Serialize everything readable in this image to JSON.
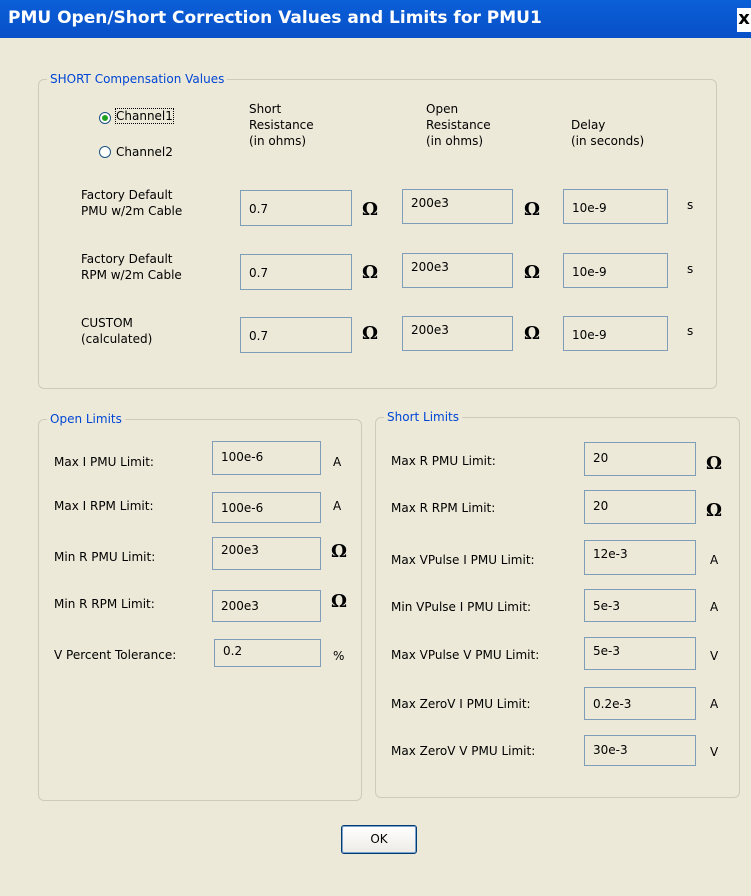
{
  "window": {
    "title": "PMU Open/Short Correction Values and Limits for PMU1",
    "close_label": "x"
  },
  "short_comp": {
    "title": "SHORT Compensation Values",
    "channels": [
      {
        "label": "Channel1",
        "selected": true
      },
      {
        "label": "Channel2",
        "selected": false
      }
    ],
    "headers": {
      "short": [
        "Short",
        "Resistance",
        "(in ohms)"
      ],
      "open": [
        "Open",
        "Resistance",
        "(in ohms)"
      ],
      "delay": [
        "Delay",
        "(in seconds)"
      ]
    },
    "rows": [
      {
        "label": [
          "Factory Default",
          "PMU w/2m Cable"
        ],
        "short": "0.7",
        "open": "200e3",
        "delay": "10e-9"
      },
      {
        "label": [
          "Factory Default",
          "RPM w/2m Cable"
        ],
        "short": "0.7",
        "open": "200e3",
        "delay": "10e-9"
      },
      {
        "label": [
          "CUSTOM",
          "(calculated)"
        ],
        "short": "0.7",
        "open": "200e3",
        "delay": "10e-9"
      }
    ],
    "ohm_symbol": "Ω",
    "sec_unit": "s"
  },
  "open_limits": {
    "title": "Open Limits",
    "rows": [
      {
        "label": "Max I PMU Limit:",
        "value": "100e-6",
        "unit": "A"
      },
      {
        "label": "Max I RPM Limit:",
        "value": "100e-6",
        "unit": "A"
      },
      {
        "label": "Min R PMU Limit:",
        "value": "200e3",
        "unit": "Ω"
      },
      {
        "label": "Min R RPM Limit:",
        "value": "200e3",
        "unit": "Ω"
      },
      {
        "label": "V Percent Tolerance:",
        "value": "0.2",
        "unit": "%"
      }
    ]
  },
  "short_limits": {
    "title": "Short Limits",
    "rows": [
      {
        "label": "Max R PMU Limit:",
        "value": "20",
        "unit": "Ω"
      },
      {
        "label": "Max R RPM Limit:",
        "value": "20",
        "unit": "Ω"
      },
      {
        "label": "Max VPulse I PMU Limit:",
        "value": "12e-3",
        "unit": "A"
      },
      {
        "label": "Min VPulse I PMU Limit:",
        "value": "5e-3",
        "unit": "A"
      },
      {
        "label": "Max VPulse V PMU Limit:",
        "value": "5e-3",
        "unit": "V"
      },
      {
        "label": "Max ZeroV I PMU Limit:",
        "value": "0.2e-3",
        "unit": "A"
      },
      {
        "label": "Max ZeroV V PMU Limit:",
        "value": "30e-3",
        "unit": "V"
      }
    ]
  },
  "ok_label": "OK"
}
